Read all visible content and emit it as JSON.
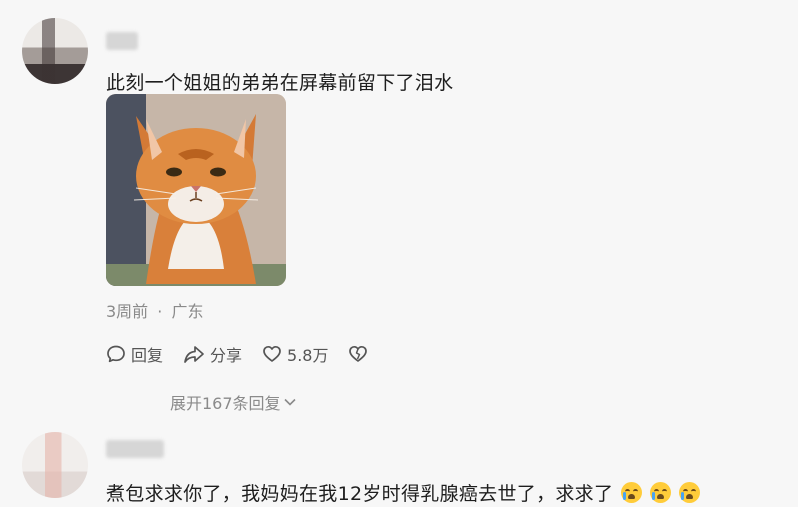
{
  "comment1": {
    "text": "此刻一个姐姐的弟弟在屏幕前留下了泪水",
    "time": "3周前",
    "separator": "·",
    "location": "广东",
    "image_description_icon": "orange-cat-photo"
  },
  "actions": {
    "reply_label": "回复",
    "share_label": "分享",
    "likes": "5.8万"
  },
  "expand_replies_label": "展开167条回复",
  "comment2": {
    "text": "煮包求求你了，我妈妈在我12岁时得乳腺癌去世了，求求了"
  },
  "icons": {
    "reply": "speech-bubble-icon",
    "share": "share-arrow-icon",
    "like": "heart-icon",
    "dislike": "broken-heart-icon",
    "expand": "chevron-down-icon",
    "emoji": "crying-face-icon"
  }
}
